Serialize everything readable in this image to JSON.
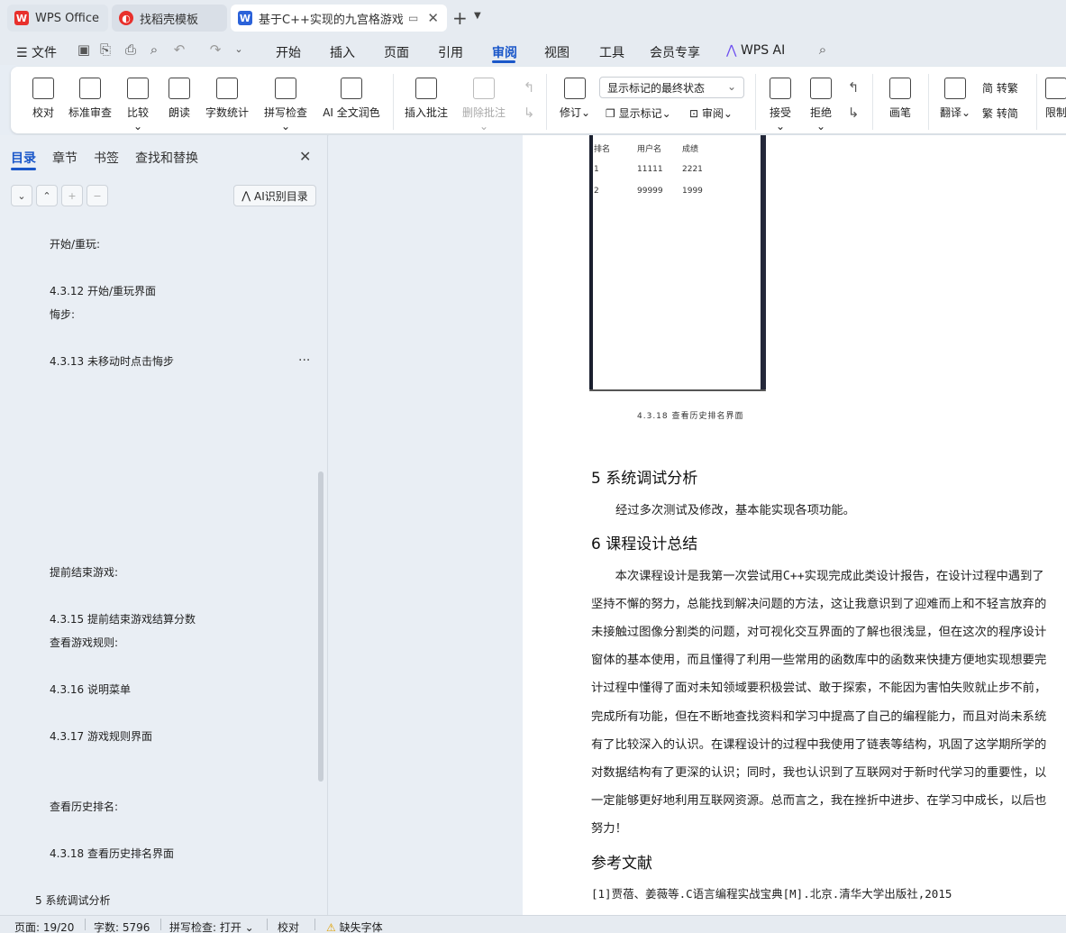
{
  "tabs": [
    {
      "label": "WPS Office",
      "icon": "wps-logo-icon"
    },
    {
      "label": "找稻壳模板",
      "icon": "docer-icon"
    },
    {
      "label": "基于C++实现的九宫格游戏 设",
      "icon": "word-doc-icon"
    }
  ],
  "menu": {
    "file": "文件",
    "items": [
      "开始",
      "插入",
      "页面",
      "引用",
      "审阅",
      "视图",
      "工具",
      "会员专享"
    ],
    "wps_ai": "WPS AI"
  },
  "ribbon": {
    "proofread": "校对",
    "standard_review": "标准审查",
    "compare": "比较",
    "read_aloud": "朗读",
    "word_count": "字数统计",
    "spell_check": "拼写检查",
    "ai_polish": "AI 全文润色",
    "insert_comment": "插入批注",
    "delete_comment": "删除批注",
    "revise": "修订",
    "markup_select": "显示标记的最终状态",
    "show_markup": "显示标记",
    "review_pane": "审阅",
    "accept": "接受",
    "reject": "拒绝",
    "pen": "画笔",
    "translate": "翻译",
    "to_traditional": "转繁",
    "to_simplified": "转简",
    "restrict": "限制"
  },
  "nav": {
    "tabs": [
      "目录",
      "章节",
      "书签",
      "查找和替换"
    ],
    "ai_toc": "AI识别目录",
    "items": [
      {
        "text": "开始/重玩:"
      },
      {
        "text": "4.3.12 开始/重玩界面"
      },
      {
        "text": "悔步:"
      },
      {
        "text": "4.3.13 未移动时点击悔步"
      },
      {
        "text": "提前结束游戏:"
      },
      {
        "text": "4.3.15 提前结束游戏结算分数"
      },
      {
        "text": "查看游戏规则:"
      },
      {
        "text": "4.3.16 说明菜单"
      },
      {
        "text": "4.3.17 游戏规则界面"
      },
      {
        "text": "查看历史排名:"
      },
      {
        "text": "4.3.18 查看历史排名界面"
      },
      {
        "text": "5 系统调试分析"
      }
    ]
  },
  "document": {
    "figure_table": {
      "headers": [
        "排名",
        "用户名",
        "成绩"
      ],
      "rows": [
        [
          "1",
          "11111",
          "2221"
        ],
        [
          "2",
          "99999",
          "1999"
        ]
      ]
    },
    "figure_caption": "4.3.18 查看历史排名界面",
    "section5_heading": "5 系统调试分析",
    "section5_text": "经过多次测试及修改，基本能实现各项功能。",
    "section6_heading": "6 课程设计总结",
    "section6_lines": [
      "　　本次课程设计是我第一次尝试用C++实现完成此类设计报告，在设计过程中遇到了",
      "坚持不懈的努力，总能找到解决问题的方法，这让我意识到了迎难而上和不轻言放弃的",
      "未接触过图像分割类的问题，对可视化交互界面的了解也很浅显，但在这次的程序设计",
      "窗体的基本使用，而且懂得了利用一些常用的函数库中的函数来快捷方便地实现想要完",
      "计过程中懂得了面对未知领域要积极尝试、敢于探索，不能因为害怕失败就止步不前，",
      "完成所有功能，但在不断地查找资料和学习中提高了自己的编程能力，而且对尚未系统",
      "有了比较深入的认识。在课程设计的过程中我使用了链表等结构，巩固了这学期所学的",
      "对数据结构有了更深的认识；同时，我也认识到了互联网对于新时代学习的重要性，以",
      "一定能够更好地利用互联网资源。总而言之，我在挫折中进步、在学习中成长，以后也",
      "努力！"
    ],
    "references_heading": "参考文献",
    "reference_1": "[1]贾蓓、姜薇等.C语言编程实战宝典[M].北京.清华大学出版社,2015"
  },
  "status": {
    "page": "页面: 19/20",
    "words": "字数: 5796",
    "spell": "拼写检查: 打开",
    "proof": "校对",
    "missing_font": "缺失字体"
  }
}
